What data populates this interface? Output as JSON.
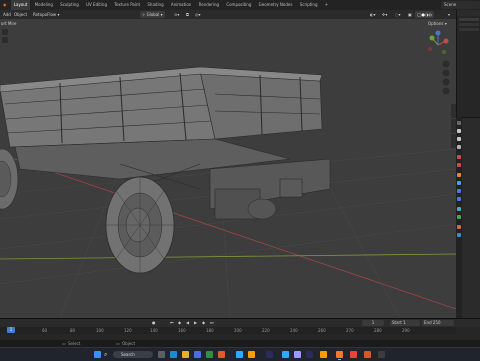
{
  "topbar": {
    "tabs": [
      "Layout",
      "Modeling",
      "Sculpting",
      "UV Editing",
      "Texture Paint",
      "Shading",
      "Animation",
      "Rendering",
      "Compositing",
      "Geometry Nodes",
      "Scripting"
    ],
    "add_tab": "+",
    "scene_name": "Scene"
  },
  "header": {
    "add": "Add",
    "object": "Object",
    "retopoflow": "RetopoFlow",
    "orientation": "Global",
    "options": "Options"
  },
  "viewport": {
    "overlay_label": "ort Mire"
  },
  "gizmo": {
    "x": "X",
    "y": "Y",
    "z": "Z"
  },
  "timeline": {
    "ticks": [
      "40",
      "60",
      "80",
      "100",
      "120",
      "140",
      "160",
      "180",
      "200",
      "220",
      "240",
      "260",
      "270",
      "280",
      "290"
    ],
    "start_label": "Start",
    "start_value": "1",
    "end_label": "End",
    "end_value": "250",
    "current_frame": "1"
  },
  "statusbar": {
    "select": "Select",
    "object": "Object"
  },
  "taskbar": {
    "search_placeholder": "Search",
    "icons": [
      "windows-start",
      "search",
      "task-view",
      "edge",
      "file-explorer",
      "store",
      "photoshop",
      "illustrator",
      "premiere",
      "after-effects",
      "blender",
      "chrome",
      "mail",
      "terminal"
    ]
  },
  "colors": {
    "viewport_bg": "#3d3d3d",
    "accent": "#3f7fd0",
    "axis_x": "#a34545",
    "axis_y": "#7b9a3a"
  }
}
